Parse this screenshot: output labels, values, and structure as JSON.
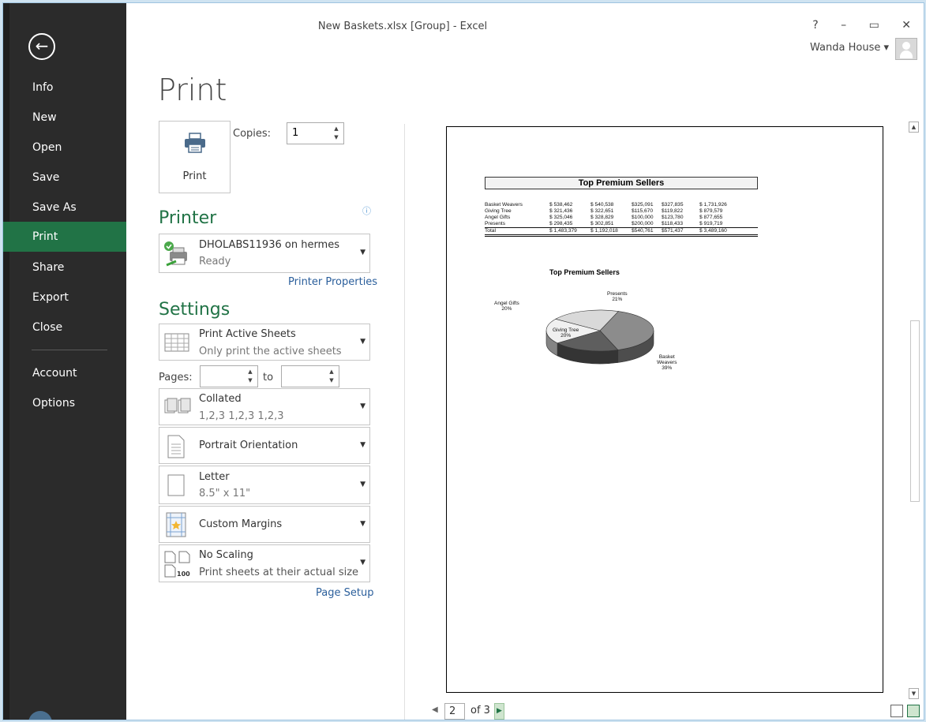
{
  "window": {
    "title": "New Baskets.xlsx  [Group] - Excel",
    "controls": "? – ▭ ✕",
    "user": "Wanda House ▾"
  },
  "sidebar": {
    "items": [
      {
        "label": "Info"
      },
      {
        "label": "New"
      },
      {
        "label": "Open"
      },
      {
        "label": "Save"
      },
      {
        "label": "Save As"
      },
      {
        "label": "Print"
      },
      {
        "label": "Share"
      },
      {
        "label": "Export"
      },
      {
        "label": "Close"
      },
      {
        "label": "Account"
      },
      {
        "label": "Options"
      }
    ]
  },
  "print": {
    "heading": "Print",
    "button_label": "Print",
    "copies_label": "Copies:",
    "copies_value": "1"
  },
  "printer": {
    "heading": "Printer",
    "name": "DHOLABS11936 on hermes",
    "status": "Ready",
    "properties_link": "Printer Properties"
  },
  "settings": {
    "heading": "Settings",
    "what": {
      "title": "Print Active Sheets",
      "sub": "Only print the active sheets"
    },
    "pages_label": "Pages:",
    "to_label": "to",
    "collation": {
      "title": "Collated",
      "sub": "1,2,3    1,2,3    1,2,3"
    },
    "orientation": {
      "title": "Portrait Orientation"
    },
    "paper": {
      "title": "Letter",
      "sub": "8.5\" x 11\""
    },
    "margins": {
      "title": "Custom Margins"
    },
    "scaling": {
      "title": "No Scaling",
      "sub": "Print sheets at their actual size",
      "icon_text": "100"
    },
    "page_setup_link": "Page Setup"
  },
  "preview": {
    "table_title": "Top Premium Sellers",
    "rows": [
      [
        "Basket Weavers",
        "$   538,462",
        "$   540,538",
        "$325,091",
        "$327,835",
        "$ 1,731,926"
      ],
      [
        "Giving Tree",
        "$   321,436",
        "$   322,651",
        "$115,670",
        "$119,822",
        "$   879,579"
      ],
      [
        "Angel Gifts",
        "$   325,046",
        "$   328,829",
        "$100,000",
        "$123,780",
        "$   877,655"
      ],
      [
        "Presents",
        "$   298,435",
        "$   302,851",
        "$200,000",
        "$118,433",
        "$   919,719"
      ]
    ],
    "total_row": [
      "Total",
      "$ 1,483,379",
      "$ 1,192,018",
      "$540,761",
      "$571,437",
      "$ 3,489,160"
    ],
    "chart_title": "Top Premium Sellers",
    "labels": {
      "angel": [
        "Angel Gifts",
        "20%"
      ],
      "presents": [
        "Presents",
        "21%"
      ],
      "giving": [
        "Giving Tree",
        "20%"
      ],
      "basket": [
        "Basket",
        "Weavers",
        "39%"
      ]
    }
  },
  "chart_data": {
    "type": "pie",
    "title": "Top Premium Sellers",
    "categories": [
      "Basket Weavers",
      "Giving Tree",
      "Angel Gifts",
      "Presents"
    ],
    "values": [
      39,
      20,
      20,
      21
    ],
    "colors": [
      "#8c8c8c",
      "#5e5e5e",
      "#f0f0f0",
      "#d9d9d9"
    ]
  },
  "pager": {
    "current": "2",
    "of_text": "of 3"
  }
}
